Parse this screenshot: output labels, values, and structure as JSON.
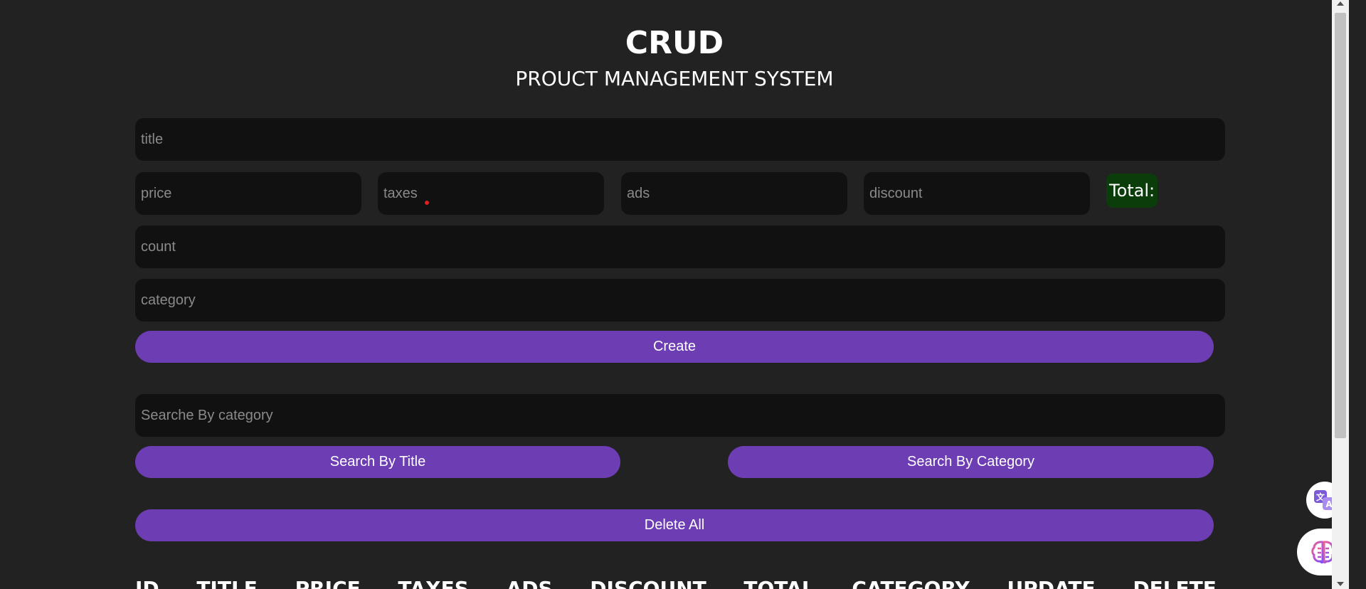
{
  "header": {
    "title": "CRUD",
    "subtitle": "PROUCT MANAGEMENT SYSTEM"
  },
  "form": {
    "title_placeholder": "title",
    "price_placeholder": "price",
    "taxes_placeholder": "taxes",
    "ads_placeholder": "ads",
    "discount_placeholder": "discount",
    "total_label": "Total:",
    "count_placeholder": "count",
    "category_placeholder": "category",
    "create_label": "Create"
  },
  "search": {
    "placeholder": "Searche By category",
    "by_title_label": "Search By Title",
    "by_category_label": "Search By Category"
  },
  "delete_all_label": "Delete All",
  "table": {
    "columns": [
      "ID",
      "TITLE",
      "PRICE",
      "TAXES",
      "ADS",
      "DISCOUNT",
      "TOTAL",
      "CATEGORY",
      "UPDATE",
      "DELETE"
    ]
  },
  "icons": {
    "translate": "translate-icon",
    "brain": "brain-icon"
  },
  "colors": {
    "background": "#222222",
    "input_bg": "#111111",
    "button": "#6c3db3",
    "total_bg": "#0b3d0b"
  }
}
